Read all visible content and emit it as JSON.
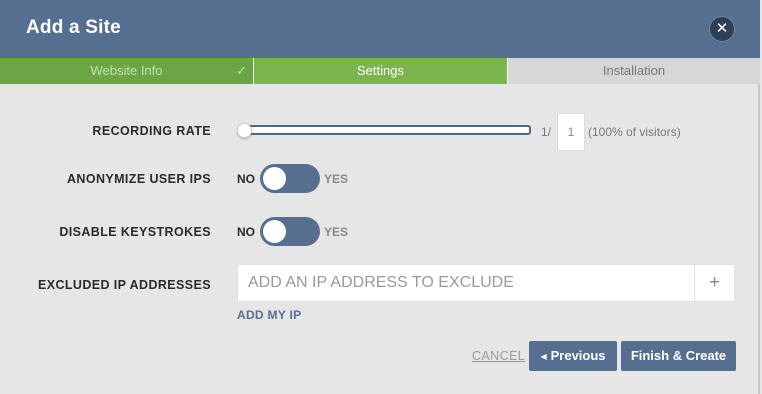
{
  "dialog": {
    "title": "Add a Site",
    "close_icon": "close-icon"
  },
  "tabs": [
    {
      "label": "Website Info",
      "state": "completed",
      "icon": "check-icon",
      "check_glyph": "✓"
    },
    {
      "label": "Settings",
      "state": "active"
    },
    {
      "label": "Installation",
      "state": "pending"
    }
  ],
  "settings": {
    "recording_rate": {
      "label": "RECORDING RATE",
      "prefix": "1/",
      "value": "1",
      "note": "(100% of visitors)",
      "slider_level": 0
    },
    "anonymize_ips": {
      "label": "ANONYMIZE USER IPS",
      "off_label": "NO",
      "on_label": "YES",
      "enabled": false
    },
    "disable_keystrokes": {
      "label": "DISABLE KEYSTROKES",
      "off_label": "NO",
      "on_label": "YES",
      "enabled": false
    },
    "excluded_ips": {
      "label": "EXCLUDED IP ADDRESSES",
      "placeholder": "ADD AN IP ADDRESS TO EXCLUDE",
      "value": "",
      "add_glyph": "+",
      "add_my_ip": "ADD MY IP"
    }
  },
  "footer": {
    "cancel": "CANCEL",
    "previous": "Previous",
    "previous_arrow": "◀",
    "finish": "Finish & Create"
  },
  "colors": {
    "header": "#566f90",
    "tab_completed": "#6ba545",
    "tab_active": "#7cb44d",
    "tab_pending": "#d7d7d7",
    "button": "#566f90",
    "background": "#e6e6e6"
  }
}
